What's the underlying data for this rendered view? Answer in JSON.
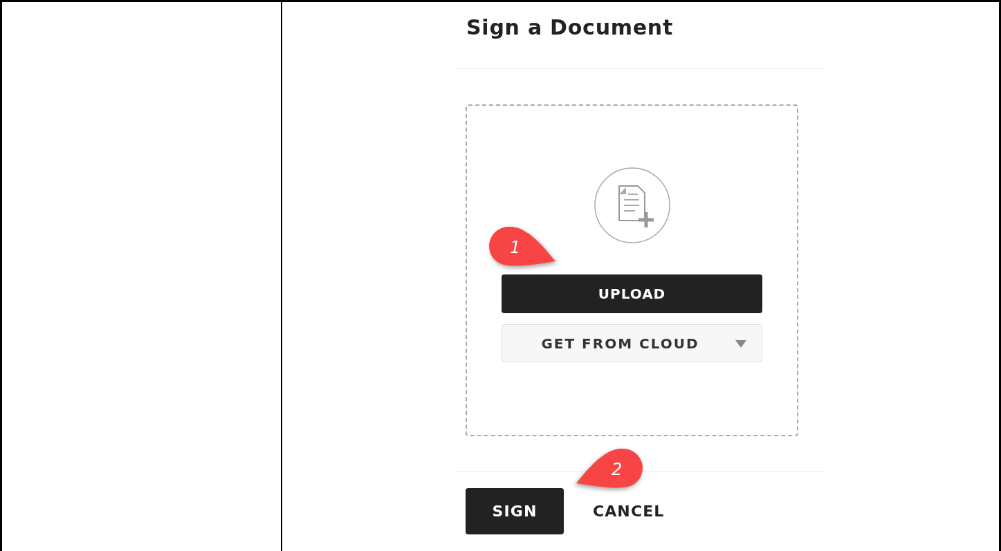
{
  "dialog": {
    "title": "Sign a Document",
    "dropzone": {
      "upload_button": "UPLOAD",
      "cloud_button": "GET FROM CLOUD"
    },
    "buttons": [
      {
        "label": "SIGN",
        "kind": "primary"
      },
      {
        "label": "CANCEL",
        "kind": "text"
      }
    ]
  },
  "callouts": [
    {
      "number": "1",
      "kind": "right"
    },
    {
      "number": "2",
      "kind": "left"
    }
  ]
}
